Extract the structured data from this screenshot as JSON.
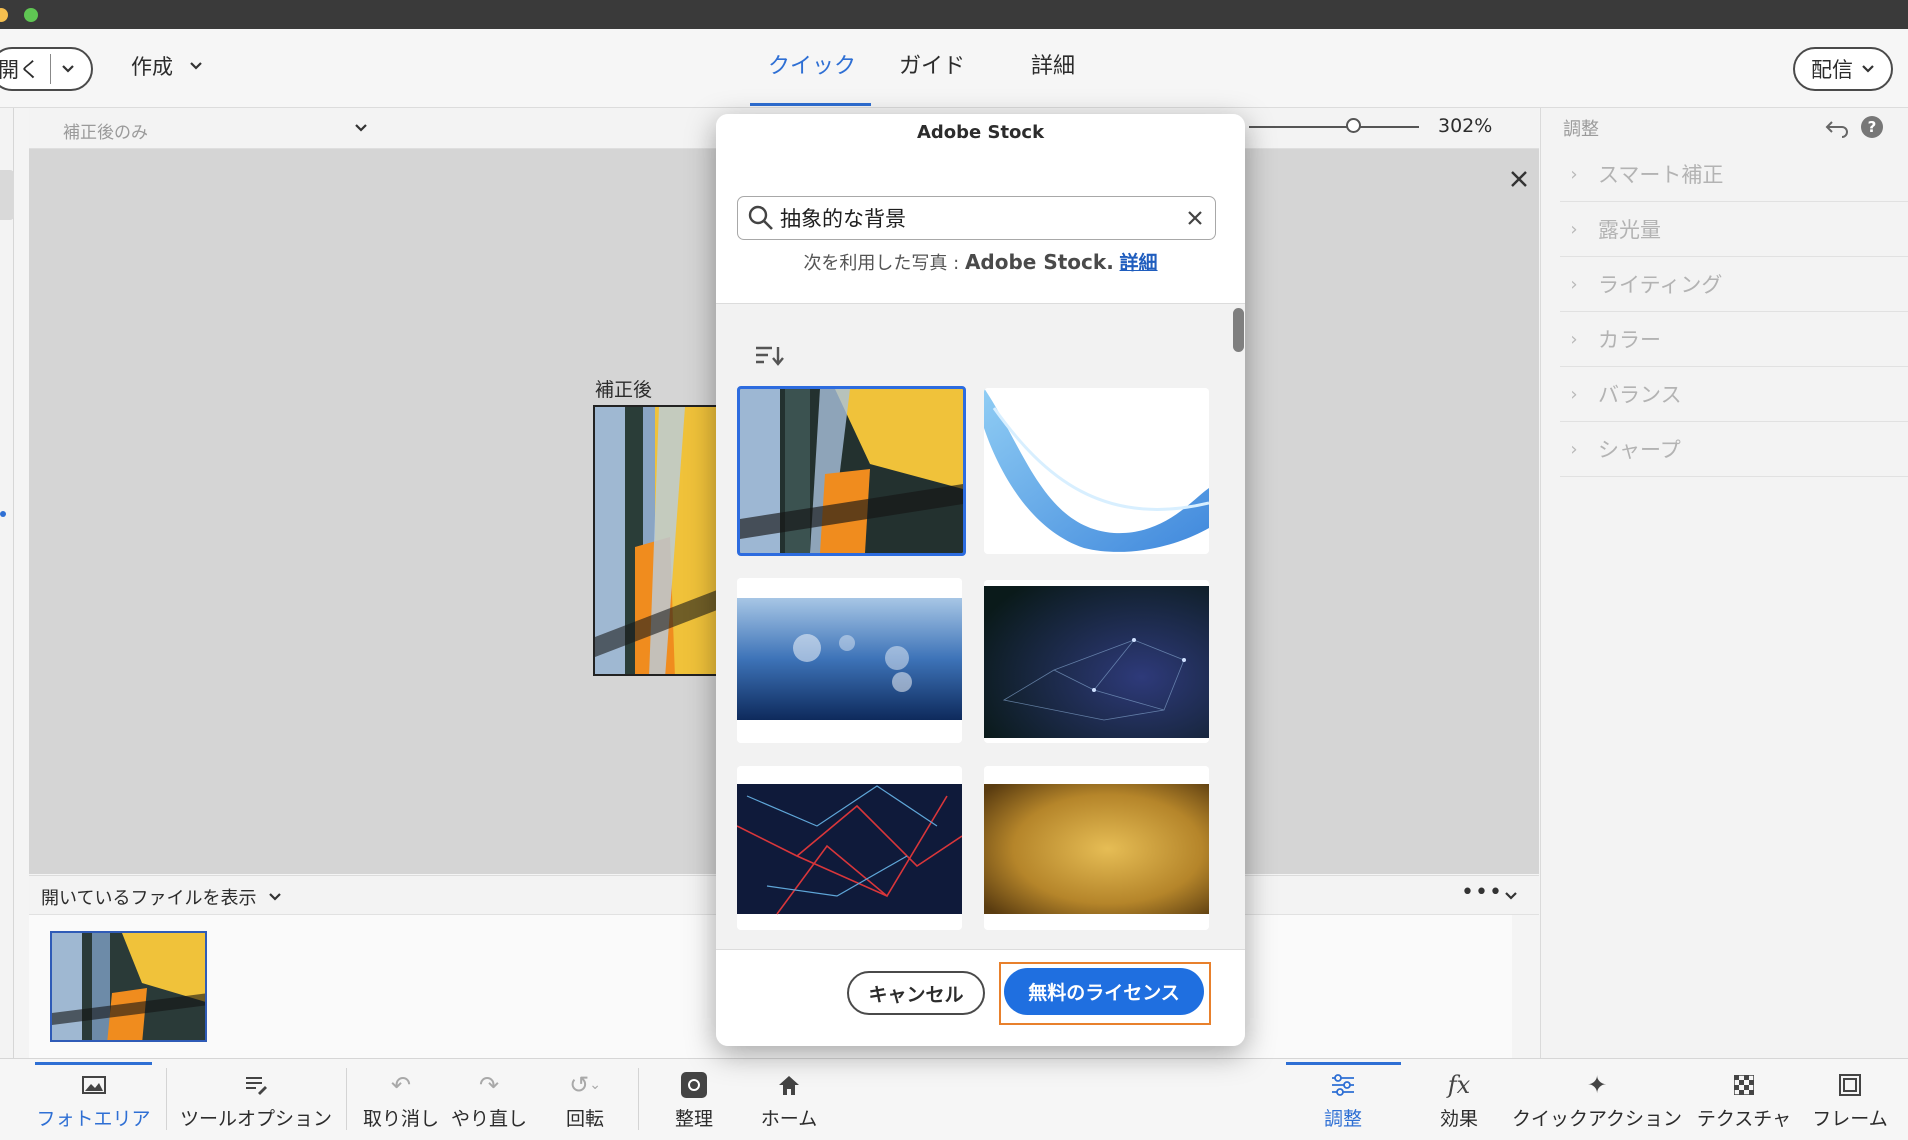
{
  "top_nav": {
    "open_label": "開く",
    "create_label": "作成",
    "modes": [
      {
        "label": "クイック",
        "active": true
      },
      {
        "label": "ガイド",
        "active": false
      },
      {
        "label": "詳細",
        "active": false
      }
    ],
    "share_label": "配信"
  },
  "sub_toolbar": {
    "view_select": "補正後のみ",
    "zoom": "302%"
  },
  "canvas": {
    "after_label": "補正後"
  },
  "right_panel": {
    "title": "調整",
    "items": [
      "スマート補正",
      "露光量",
      "ライティング",
      "カラー",
      "バランス",
      "シャープ"
    ]
  },
  "file_bin": {
    "label": "開いているファイルを表示"
  },
  "bottom_bar": {
    "items": [
      {
        "label": "フォトエリア",
        "icon": "photo-icon",
        "active": true
      },
      {
        "label": "ツールオプション",
        "icon": "tool-options-icon"
      },
      {
        "label": "取り消し",
        "icon": "undo-icon"
      },
      {
        "label": "やり直し",
        "icon": "redo-icon"
      },
      {
        "label": "回転",
        "icon": "rotate-icon"
      },
      {
        "label": "整理",
        "icon": "organize-icon"
      },
      {
        "label": "ホーム",
        "icon": "home-icon"
      },
      {
        "label": "調整",
        "icon": "adjust-icon",
        "active": true
      },
      {
        "label": "効果",
        "icon": "fx-icon"
      },
      {
        "label": "クイックアクション",
        "icon": "sparkle-icon"
      },
      {
        "label": "テクスチャ",
        "icon": "texture-icon"
      },
      {
        "label": "フレーム",
        "icon": "frame-icon"
      }
    ]
  },
  "modal": {
    "title": "Adobe Stock",
    "search_value": "抽象的な背景",
    "credit_prefix": "次を利用した写真 : ",
    "credit_brand": "Adobe Stock.",
    "credit_link": "詳細",
    "cancel_label": "キャンセル",
    "license_label": "無料のライセンス"
  },
  "colors": {
    "accent": "#2e6fd4",
    "primary_button": "#1f6fe0",
    "highlight_outline": "#e8802c"
  }
}
